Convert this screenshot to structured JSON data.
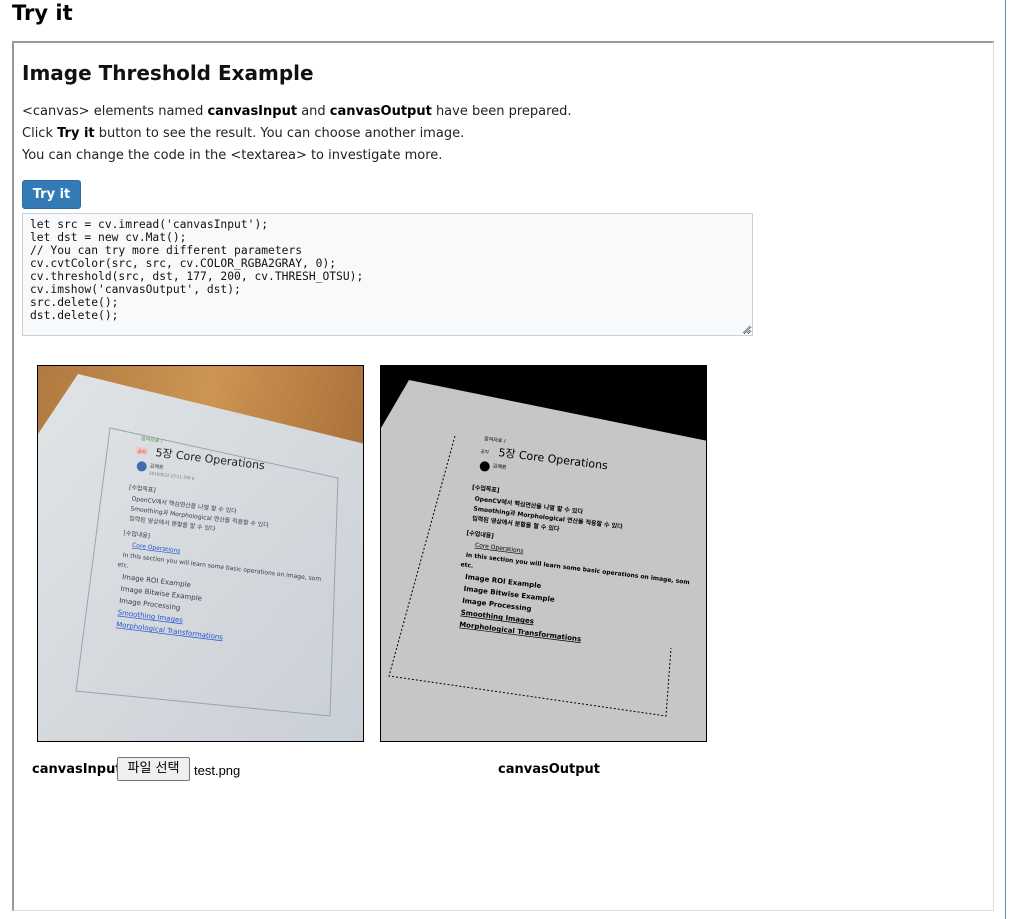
{
  "page": {
    "heading": "Try it"
  },
  "example": {
    "title": "Image Threshold Example",
    "line1": {
      "pre": "<canvas> elements named ",
      "b1": "canvasInput",
      "mid": " and ",
      "b2": "canvasOutput",
      "post": " have been prepared."
    },
    "line2": {
      "pre": "Click ",
      "b": "Try it",
      "post": " button to see the result. You can choose another image."
    },
    "line3": "You can change the code in the <textarea> to investigate more.",
    "try_button": "Try it",
    "code": "let src = cv.imread('canvasInput');\nlet dst = new cv.Mat();\n// You can try more different parameters\ncv.cvtColor(src, src, cv.COLOR_RGBA2GRAY, 0);\ncv.threshold(src, dst, 177, 200, cv.THRESH_OTSU);\ncv.imshow('canvasOutput', dst);\nsrc.delete();\ndst.delete();"
  },
  "canvases": {
    "input_label": "canvasInput",
    "file_button": "파일 선택",
    "file_name": "test.png",
    "output_label": "canvasOutput"
  },
  "document_in_image": {
    "header_small": "참여자료 /",
    "badge": "공지",
    "title": "5장 Core Operations",
    "author": "김예원",
    "date": "2018/8/22 23:11 조회 6",
    "goals_heading": "[수업목표]",
    "goals": [
      "OpenCV에서 핵심연산을 나열 할 수 있다",
      "Smoothing과 Morphological 연산을 적용할 수 있다",
      "입력된 영상에서 분할을 할 수 있다"
    ],
    "content_heading": "[수업내용]",
    "core_link": "Core Operations",
    "section_text": "In this section you will learn some basic operations on image, som",
    "section_text2": "etc.",
    "items": [
      "Image ROI Example",
      "Image Bitwise Example",
      "Image Processing"
    ],
    "links": [
      "Smoothing Images",
      "Morphological Transformations"
    ]
  },
  "colors": {
    "try_button": "#337ab7",
    "link": "#2255cc",
    "wood": "#c08a4a",
    "paper": "#d6dbe0"
  }
}
